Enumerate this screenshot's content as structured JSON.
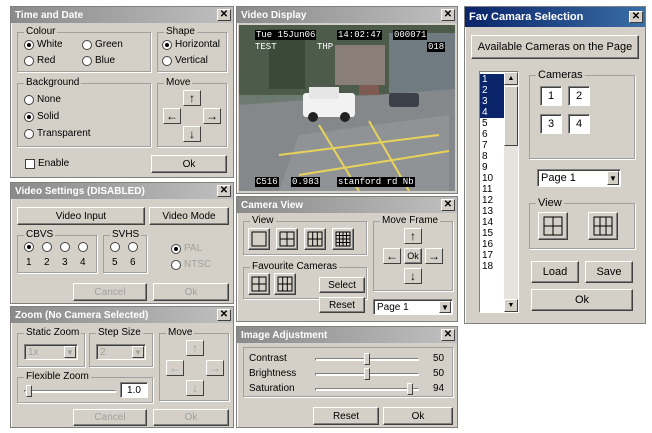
{
  "time_date": {
    "title": "Time and Date",
    "colour_label": "Colour",
    "colours": [
      "White",
      "Green",
      "Red",
      "Blue"
    ],
    "shape_label": "Shape",
    "shapes": [
      "Horizontal",
      "Vertical"
    ],
    "background_label": "Background",
    "backgrounds": [
      "None",
      "Solid",
      "Transparent"
    ],
    "move_label": "Move",
    "enable_label": "Enable",
    "ok_label": "Ok"
  },
  "video_display": {
    "title": "Video Display",
    "overlay_top_left": "Tue 15Jun06",
    "overlay_time": "14:02:47",
    "overlay_code": "000071",
    "overlay_test": "TEST",
    "overlay_thp": "THP",
    "overlay_018": "018",
    "overlay_bottom_id": "C516",
    "overlay_bottom_val": "0.983",
    "overlay_bottom_loc": "stanford rd Nb"
  },
  "fav_camera": {
    "title": "Fav Camara Selection",
    "available_label": "Available Cameras on the Page",
    "camera_list": [
      "1",
      "2",
      "3",
      "4",
      "5",
      "6",
      "7",
      "8",
      "9",
      "10",
      "11",
      "12",
      "13",
      "14",
      "15",
      "16",
      "17",
      "18"
    ],
    "cameras_label": "Cameras",
    "camera_slots": [
      "1",
      "2",
      "3",
      "4"
    ],
    "page_select": "Page 1",
    "view_label": "View",
    "load_label": "Load",
    "save_label": "Save",
    "ok_label": "Ok"
  },
  "video_settings": {
    "title": "Video Settings (DISABLED)",
    "video_input_label": "Video Input",
    "video_mode_label": "Video Mode",
    "cbvs_label": "CBVS",
    "svhs_label": "SVHS",
    "cbvs_nums": [
      "1",
      "2",
      "3",
      "4"
    ],
    "svhs_nums": [
      "5",
      "6"
    ],
    "pal_label": "PAL",
    "ntsc_label": "NTSC",
    "cancel_label": "Cancel",
    "ok_label": "Ok"
  },
  "camera_view": {
    "title": "Camera View",
    "view_label": "View",
    "move_frame_label": "Move Frame",
    "ok_center": "Ok",
    "favourite_label": "Favourite Cameras",
    "select_label": "Select",
    "reset_label": "Reset",
    "page_select": "Page  1"
  },
  "zoom": {
    "title": "Zoom (No Camera Selected)",
    "static_zoom_label": "Static Zoom",
    "static_zoom_value": "1x",
    "step_size_label": "Step Size",
    "step_size_value": "2",
    "move_label": "Move",
    "flexible_zoom_label": "Flexible Zoom",
    "flexible_zoom_value": "1.0",
    "cancel_label": "Cancel",
    "ok_label": "Ok"
  },
  "image_adjustment": {
    "title": "Image Adjustment",
    "sliders": [
      {
        "label": "Contrast",
        "value": "50",
        "fraction": 0.5
      },
      {
        "label": "Brightness",
        "value": "50",
        "fraction": 0.5
      },
      {
        "label": "Saturation",
        "value": "94",
        "fraction": 0.94
      }
    ],
    "reset_label": "Reset",
    "ok_label": "Ok"
  },
  "colors": {
    "active_title": "#0a246a",
    "inactive_title": "#8a8a8a",
    "list_selection": "#0a246a"
  }
}
